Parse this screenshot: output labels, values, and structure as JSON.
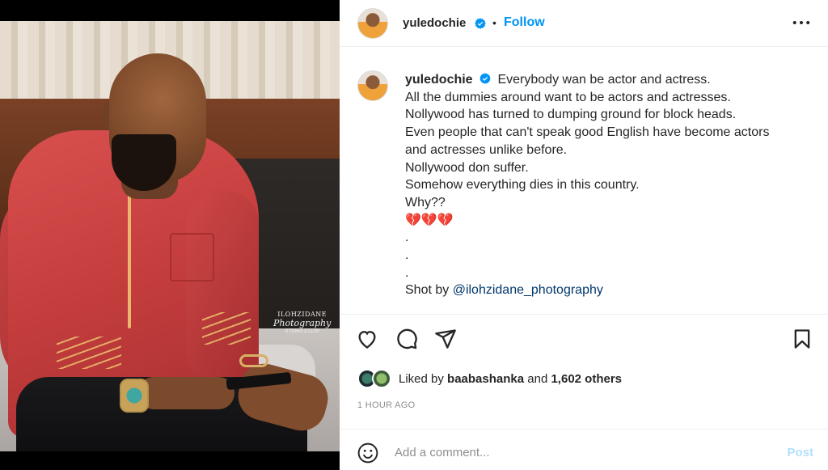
{
  "post": {
    "username": "yuledochie",
    "follow_label": "Follow",
    "separator": "•",
    "caption_lines": [
      "Everybody wan be actor and actress.",
      "All the dummies around want to be actors and actresses.",
      "Nollywood has turned to dumping ground for block heads.",
      "Even people that can't speak good English have become actors",
      "and actresses unlike before.",
      "Nollywood don suffer.",
      "Somehow everything dies in this country.",
      "Why??",
      "💔💔💔",
      ".",
      ".",
      "."
    ],
    "shot_by_prefix": "Shot by ",
    "shot_by_mention": "@ilohzidane_photography",
    "likes_prefix": "Liked by ",
    "liked_by_user": "baabashanka",
    "likes_middle": " and ",
    "likes_count": "1,602 others",
    "time_ago": "1 HOUR AGO",
    "comment_placeholder": "Add a comment...",
    "post_label": "Post"
  },
  "watermark": {
    "brand": "ILOHZIDANE",
    "script": "Photography",
    "phone": "07066123239"
  },
  "icons": {
    "verified": "verified-badge-icon",
    "more": "more-options-icon",
    "like": "heart-icon",
    "comment": "comment-icon",
    "share": "share-icon",
    "save": "bookmark-icon",
    "emoji": "emoji-icon"
  },
  "colors": {
    "accent": "#0095f6",
    "post_disabled": "#b2dffc",
    "muted": "#8e8e8e",
    "mention": "#00376b"
  }
}
